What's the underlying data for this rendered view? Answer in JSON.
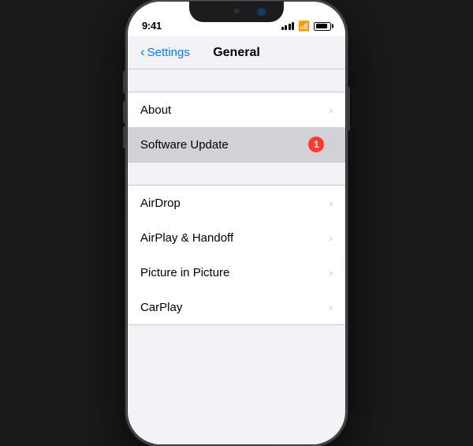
{
  "status_bar": {
    "time": "9:41",
    "signal_bars": [
      5,
      7,
      9,
      11,
      13
    ],
    "wifi_symbol": "wifi",
    "battery_level": 85
  },
  "navigation": {
    "back_label": "Settings",
    "title": "General"
  },
  "sections": [
    {
      "id": "section1",
      "rows": [
        {
          "id": "about",
          "label": "About",
          "badge": null,
          "highlighted": false
        },
        {
          "id": "software-update",
          "label": "Software Update",
          "badge": "1",
          "highlighted": true
        }
      ]
    },
    {
      "id": "section2",
      "rows": [
        {
          "id": "airdrop",
          "label": "AirDrop",
          "badge": null,
          "highlighted": false
        },
        {
          "id": "airplay-handoff",
          "label": "AirPlay & Handoff",
          "badge": null,
          "highlighted": false
        },
        {
          "id": "picture-in-picture",
          "label": "Picture in Picture",
          "badge": null,
          "highlighted": false
        },
        {
          "id": "carplay",
          "label": "CarPlay",
          "badge": null,
          "highlighted": false
        }
      ]
    }
  ],
  "colors": {
    "blue": "#007aff",
    "red": "#ff3b30",
    "chevron": "#c7c7cc",
    "separator": "#c8c8cc",
    "highlighted_bg": "#d1d1d6"
  }
}
